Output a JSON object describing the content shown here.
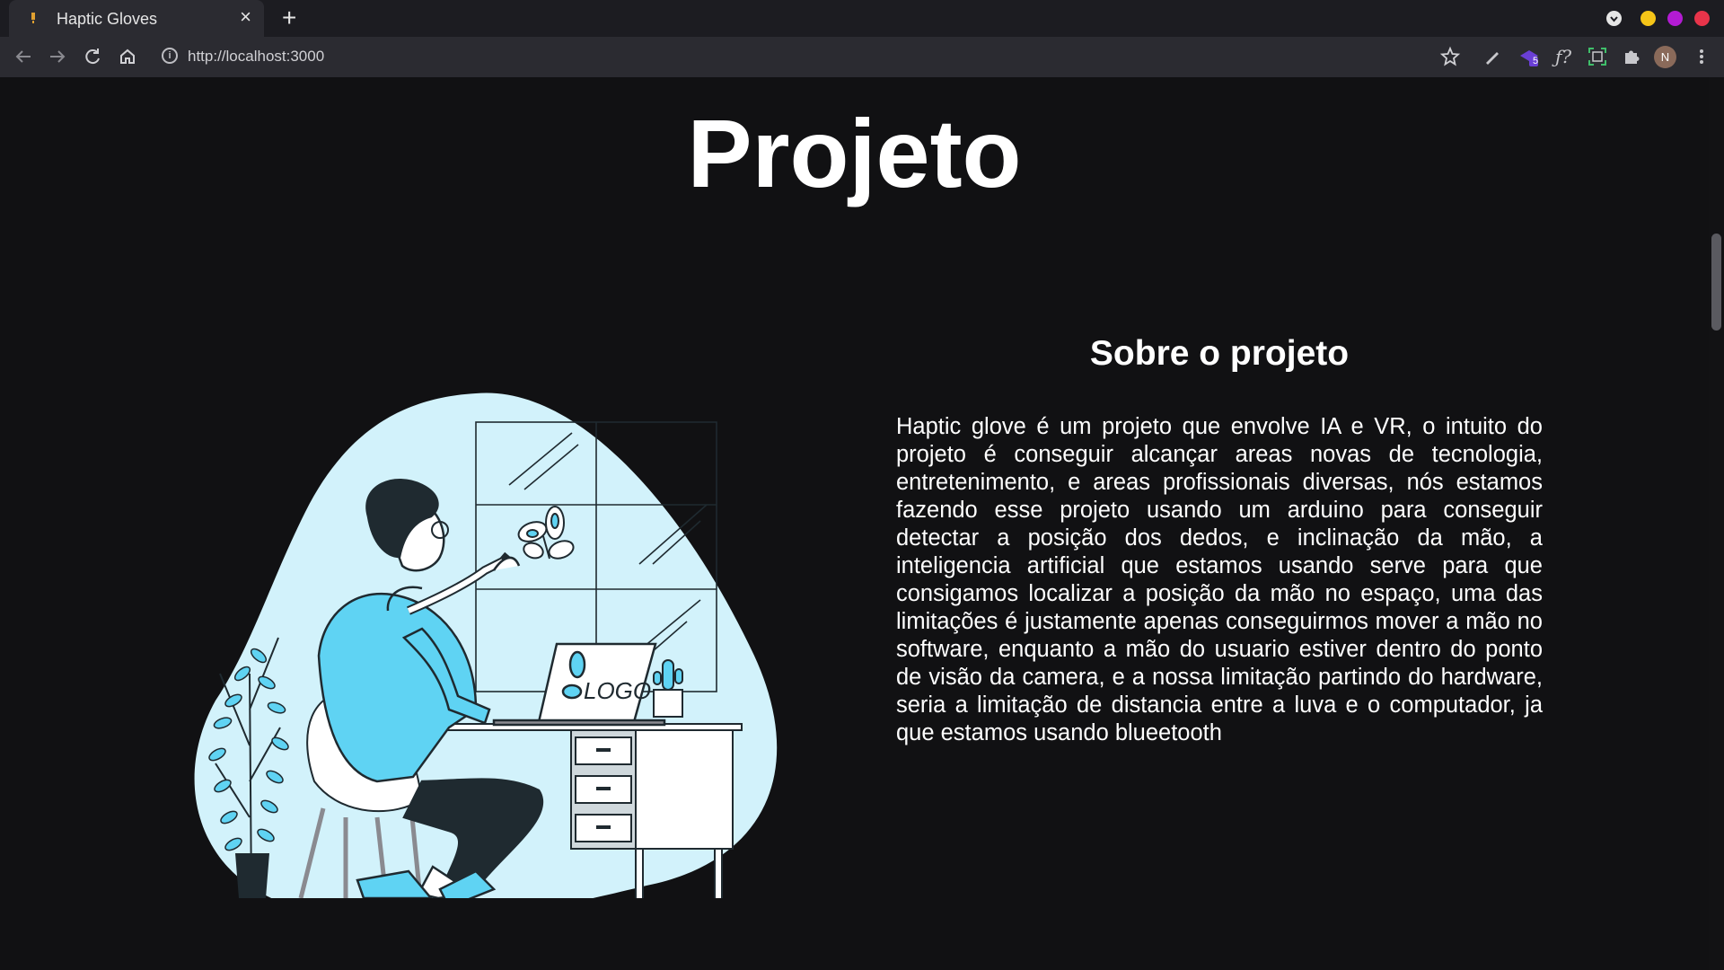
{
  "browser": {
    "tab_title": "Haptic Gloves",
    "tab_close": "×",
    "new_tab": "+",
    "url": "http://localhost:3000",
    "avatar_initial": "N",
    "extension_badge": "5",
    "icons": [
      "back-icon",
      "forward-icon",
      "reload-icon",
      "home-icon",
      "info-icon",
      "star-icon",
      "pen-icon",
      "extension-icon",
      "formula-icon",
      "capture-icon",
      "puzzle-icon",
      "menu-icon"
    ],
    "window_colors": {
      "minimize": "#f5c518",
      "maximize": "#b31bd3",
      "close": "#e8344a"
    }
  },
  "page": {
    "title": "Projeto",
    "section_title": "Sobre o projeto",
    "section_text": "Haptic glove é um projeto que envolve IA e VR, o intuito do projeto é conseguir alcançar areas novas de tecnologia, entretenimento, e areas profissionais diversas, nós estamos fazendo esse projeto usando um arduino para conseguir detectar a posição dos dedos, e inclinação da mão, a inteligencia artificial que estamos usando serve para que consigamos localizar a posição da mão no espaço, uma das limitações é justamente apenas conseguirmos mover a mão no software, enquanto a mão do usuario estiver dentro do ponto de visão da camera, e a nossa limitação partindo do hardware, seria a limitação de distancia entre a luva e o computador, ja que estamos usando blueetooth",
    "illustration_logo_text": "LOGO",
    "accent_color": "#5fd3f3",
    "blob_color": "#d2f2fb"
  }
}
